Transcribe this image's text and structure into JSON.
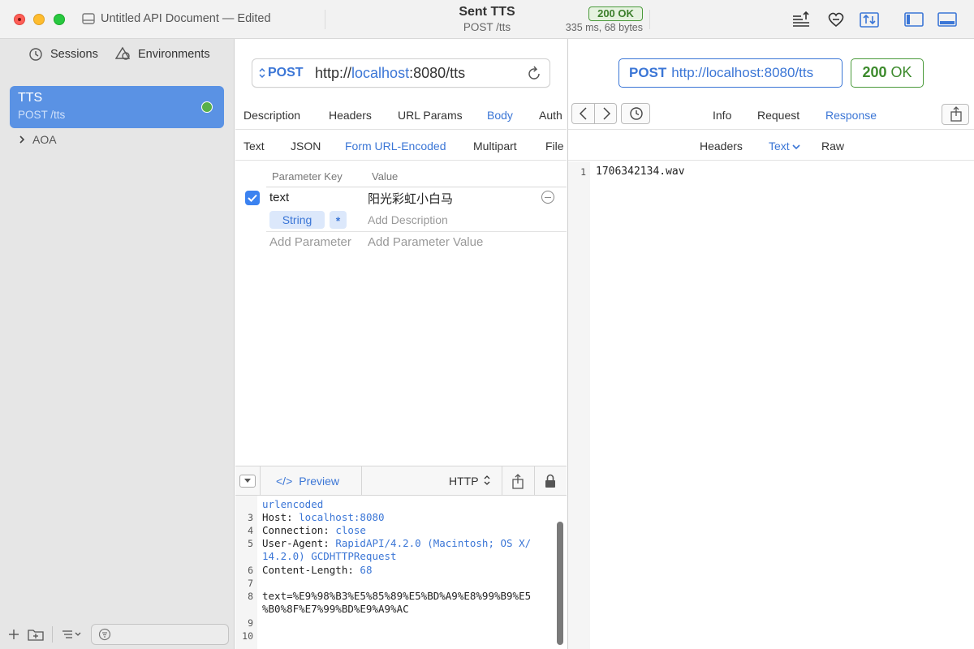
{
  "window": {
    "doc_title": "Untitled API Document — Edited",
    "sent_title": "Sent TTS",
    "sent_sub": "POST /tts",
    "status_badge": "200 OK",
    "timing": "335 ms, 68 bytes"
  },
  "sidebar": {
    "tab_sessions": "Sessions",
    "tab_environments": "Environments",
    "selected": {
      "title": "TTS",
      "subtitle": "POST /tts",
      "status_color": "#58b04a"
    },
    "group": "AOA"
  },
  "request": {
    "method": "POST",
    "url_prefix": "http://",
    "url_host": "localhost",
    "url_rest": ":8080/tts",
    "tabs": [
      "Description",
      "Headers",
      "URL Params",
      "Body",
      "Auth"
    ],
    "active_tab": "Body",
    "body_types": [
      "Text",
      "JSON",
      "Form URL-Encoded",
      "Multipart",
      "File"
    ],
    "active_body_type": "Form URL-Encoded",
    "param_header_key": "Parameter Key",
    "param_header_value": "Value",
    "param": {
      "key": "text",
      "value": "阳光彩虹小白马",
      "type": "String",
      "required": "*",
      "desc_placeholder": "Add Description"
    },
    "add_key_placeholder": "Add Parameter",
    "add_value_placeholder": "Add Parameter Value"
  },
  "code_pane": {
    "preview_label": "Preview",
    "format_label": "HTTP",
    "partial_line": "urlencoded",
    "lines": [
      {
        "num": "3",
        "key": "Host: ",
        "val": "localhost:8080"
      },
      {
        "num": "4",
        "key": "Connection: ",
        "val": "close"
      },
      {
        "num": "5",
        "key": "User-Agent: ",
        "val": "RapidAPI/4.2.0 (Macintosh; OS X/"
      },
      {
        "num": "",
        "key": "",
        "val": "14.2.0) GCDHTTPRequest"
      },
      {
        "num": "6",
        "key": "Content-Length: ",
        "val": "68"
      },
      {
        "num": "7",
        "key": "",
        "val": ""
      },
      {
        "num": "8",
        "key": "text=%E9%98%B3%E5%85%89%E5%BD%A9%E8%99%B9%E5",
        "val": ""
      },
      {
        "num": "",
        "key": "%B0%8F%E7%99%BD%E9%A9%AC",
        "val": ""
      },
      {
        "num": "9",
        "key": "",
        "val": ""
      },
      {
        "num": "10",
        "key": "",
        "val": ""
      }
    ]
  },
  "response": {
    "method": "POST",
    "url": "http://localhost:8080/tts",
    "status_code": "200",
    "status_text": "OK",
    "tabs": [
      "Info",
      "Request",
      "Response"
    ],
    "active_tab": "Response",
    "sub_tabs": [
      "Headers",
      "Text",
      "Raw"
    ],
    "active_sub_tab": "Text",
    "body_line_num": "1",
    "body_line": "1706342134.wav"
  },
  "colors": {
    "accent": "#3b76d6",
    "success": "#3c8a2c",
    "sidebar_selection": "#5a92e4"
  }
}
